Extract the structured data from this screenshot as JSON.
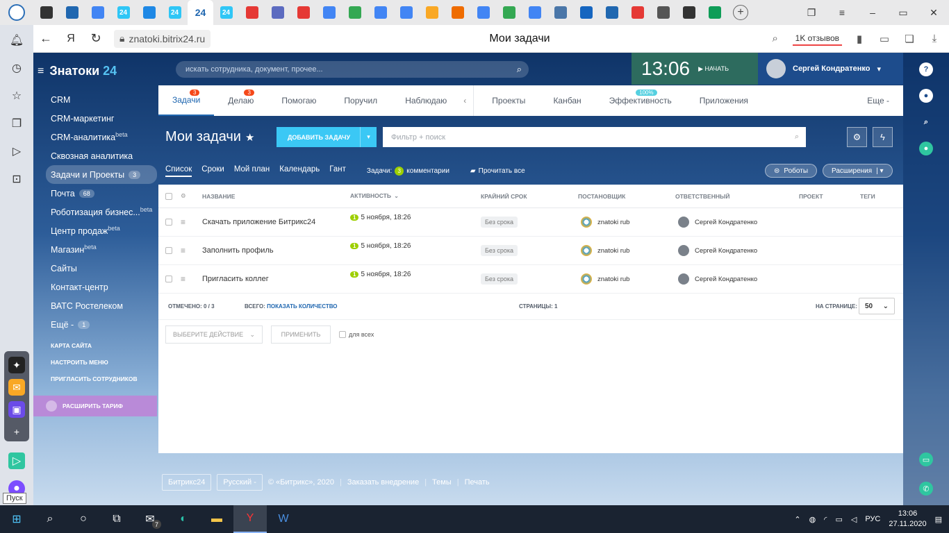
{
  "browser": {
    "tabs": [
      {
        "icon": "circle-icon",
        "color": "#333333"
      },
      {
        "icon": "mail-icon",
        "color": "#2067b0"
      },
      {
        "icon": "doc-icon",
        "color": "#4285f4"
      },
      {
        "icon": "b24-icon",
        "color": "#2fc6f6",
        "text": "24"
      },
      {
        "icon": "star-icon",
        "color": "#1e88e5"
      },
      {
        "icon": "b24-icon",
        "color": "#2fc6f6",
        "text": "24"
      },
      {
        "icon": "b24-icon",
        "color": "#2067b0",
        "text": "24"
      },
      {
        "icon": "b24-icon",
        "color": "#2fc6f6",
        "text": "24"
      },
      {
        "icon": "b-icon",
        "color": "#e53935"
      },
      {
        "icon": "flag-icon",
        "color": "#5c6bc0"
      },
      {
        "icon": "link-icon",
        "color": "#e53935"
      },
      {
        "icon": "doc-icon",
        "color": "#4285f4"
      },
      {
        "icon": "drive-icon",
        "color": "#34a853"
      },
      {
        "icon": "doc-icon",
        "color": "#4285f4"
      },
      {
        "icon": "doc-icon",
        "color": "#4285f4"
      },
      {
        "icon": "gmail-icon",
        "color": "#f9a825"
      },
      {
        "icon": "ball-icon",
        "color": "#ef6c00"
      },
      {
        "icon": "doc-icon",
        "color": "#4285f4"
      },
      {
        "icon": "drive-icon",
        "color": "#34a853"
      },
      {
        "icon": "doc-icon",
        "color": "#4285f4"
      },
      {
        "icon": "vk-icon",
        "color": "#4a76a8"
      },
      {
        "icon": "at-icon",
        "color": "#1565c0"
      },
      {
        "icon": "mail-icon",
        "color": "#2067b0"
      },
      {
        "icon": "yandex-icon",
        "color": "#e53935"
      },
      {
        "icon": "gear-icon",
        "color": "#555555"
      },
      {
        "icon": "circle-icon",
        "color": "#333333"
      },
      {
        "icon": "plus-square-icon",
        "color": "#0f9d58"
      }
    ],
    "active_tab_text": "24",
    "url": "znatoki.bitrix24.ru",
    "page_title": "Мои задачи",
    "reviews": "1K отзывов"
  },
  "bitrix": {
    "brand": "Знатоки",
    "brand_num": "24",
    "search_placeholder": "искать сотрудника, документ, прочее...",
    "clock": "13:06",
    "start_label": "НАЧАТЬ",
    "user_name": "Сергей Кондратенко",
    "menu": [
      {
        "label": "CRM",
        "sup": "",
        "count": ""
      },
      {
        "label": "CRM-маркетинг",
        "sup": "",
        "count": ""
      },
      {
        "label": "CRM-аналитика",
        "sup": "beta",
        "count": ""
      },
      {
        "label": "Сквозная аналитика",
        "sup": "",
        "count": ""
      },
      {
        "label": "Задачи и Проекты",
        "sup": "",
        "count": "3"
      },
      {
        "label": "Почта",
        "sup": "",
        "count": "68"
      },
      {
        "label": "Роботизация бизнес...",
        "sup": "beta",
        "count": ""
      },
      {
        "label": "Центр продаж",
        "sup": "beta",
        "count": ""
      },
      {
        "label": "Магазин",
        "sup": "beta",
        "count": ""
      },
      {
        "label": "Сайты",
        "sup": "",
        "count": ""
      },
      {
        "label": "Контакт-центр",
        "sup": "",
        "count": ""
      },
      {
        "label": "ВАТС Ростелеком",
        "sup": "",
        "count": ""
      },
      {
        "label": "Ещё -",
        "sup": "",
        "count": "1"
      }
    ],
    "menu_links": [
      "КАРТА САЙТА",
      "НАСТРОИТЬ МЕНЮ",
      "ПРИГЛАСИТЬ СОТРУДНИКОВ"
    ],
    "tarif": "РАСШИРИТЬ ТАРИФ",
    "tabs": [
      {
        "label": "Задачи",
        "badge": "3"
      },
      {
        "label": "Делаю",
        "badge": "3"
      },
      {
        "label": "Помогаю",
        "badge": ""
      },
      {
        "label": "Поручил",
        "badge": ""
      },
      {
        "label": "Наблюдаю",
        "badge": ""
      }
    ],
    "tabs2": [
      {
        "label": "Проекты",
        "badge": ""
      },
      {
        "label": "Канбан",
        "badge": ""
      },
      {
        "label": "Эффективность",
        "badge": "100%"
      },
      {
        "label": "Приложения",
        "badge": ""
      }
    ],
    "more": "Еще -",
    "page_title": "Мои задачи",
    "add_task": "ДОБАВИТЬ ЗАДАЧУ",
    "filter_placeholder": "Фильтр + поиск",
    "views": [
      "Список",
      "Сроки",
      "Мой план",
      "Календарь",
      "Гант"
    ],
    "tasks_label": "Задачи:",
    "comments_count": "3",
    "comments_label": "комментарии",
    "read_all": "Прочитать все",
    "robots": "Роботы",
    "extensions": "Расширения",
    "columns": [
      "НАЗВАНИЕ",
      "АКТИВНОСТЬ",
      "КРАЙНИЙ СРОК",
      "ПОСТАНОВЩИК",
      "ОТВЕТСТВЕННЫЙ",
      "ПРОЕКТ",
      "ТЕГИ"
    ],
    "rows": [
      {
        "title": "Скачать приложение Битрикс24",
        "activity_count": "1",
        "activity": "5 ноября, 18:26",
        "deadline": "Без срока",
        "creator": "znatoki rub",
        "responsible": "Сергей Кондратенко"
      },
      {
        "title": "Заполнить профиль",
        "activity_count": "1",
        "activity": "5 ноября, 18:26",
        "deadline": "Без срока",
        "creator": "znatoki rub",
        "responsible": "Сергей Кондратенко"
      },
      {
        "title": "Пригласить коллег",
        "activity_count": "1",
        "activity": "5 ноября, 18:26",
        "deadline": "Без срока",
        "creator": "znatoki rub",
        "responsible": "Сергей Кондратенко"
      }
    ],
    "selected": "ОТМЕЧЕНО: 0 / 3",
    "total_label": "ВСЕГО:",
    "total_link": "ПОКАЗАТЬ КОЛИЧЕСТВО",
    "pages": "СТРАНИЦЫ:  1",
    "per_page_label": "НА СТРАНИЦЕ:",
    "per_page": "50",
    "choose_action": "ВЫБЕРИТЕ ДЕЙСТВИЕ",
    "apply": "ПРИМЕНИТЬ",
    "for_all": "для всех",
    "footer": {
      "logo": "Битрикс24",
      "lang": "Русский -",
      "copy": "© «Битрикс», 2020",
      "order": "Заказать внедрение",
      "themes": "Темы",
      "print": "Печать"
    }
  },
  "taskbar": {
    "start_tooltip": "Пуск",
    "mail_badge": "7",
    "lang": "РУС",
    "time": "13:06",
    "date": "27.11.2020"
  }
}
